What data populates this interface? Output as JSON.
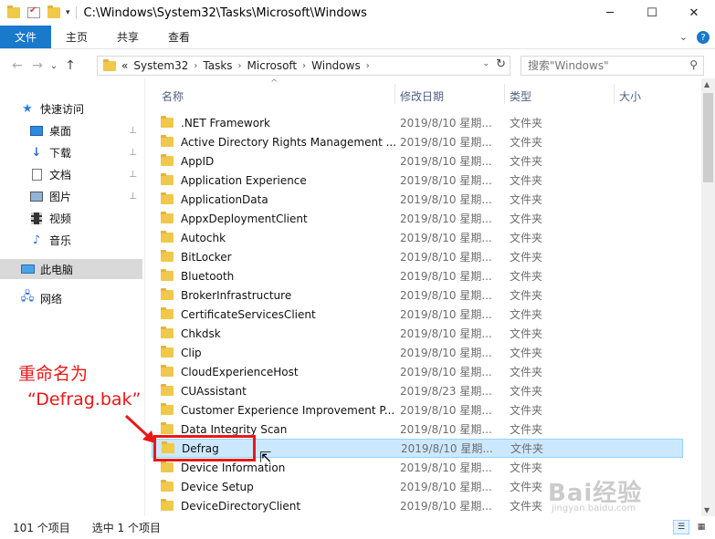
{
  "window": {
    "path_title": "C:\\Windows\\System32\\Tasks\\Microsoft\\Windows",
    "min_glyph": "─",
    "max_glyph": "☐",
    "close_glyph": "✕"
  },
  "ribbon": {
    "tabs": [
      "文件",
      "主页",
      "共享",
      "查看"
    ],
    "collapse_glyph": "⌄",
    "help_glyph": "?"
  },
  "nav": {
    "back_glyph": "←",
    "forward_glyph": "→",
    "recent_glyph": "⌄",
    "up_glyph": "↑",
    "breadcrumb_prefix": "«",
    "breadcrumbs": [
      "System32",
      "Tasks",
      "Microsoft",
      "Windows"
    ],
    "crumb_sep": "›",
    "refresh_glyph": "↻",
    "dropdown_glyph": "⌄"
  },
  "search": {
    "placeholder": "搜索\"Windows\"",
    "icon_glyph": "⚲"
  },
  "sidebar": {
    "quick_access": "快速访问",
    "items": [
      {
        "label": "桌面",
        "icon": "desktop-icon",
        "pinned": true
      },
      {
        "label": "下载",
        "icon": "download-icon",
        "pinned": true
      },
      {
        "label": "文档",
        "icon": "document-icon",
        "pinned": true
      },
      {
        "label": "图片",
        "icon": "picture-icon",
        "pinned": true
      },
      {
        "label": "视频",
        "icon": "video-icon",
        "pinned": false
      },
      {
        "label": "音乐",
        "icon": "music-icon",
        "pinned": false
      }
    ],
    "this_pc": "此电脑",
    "network": "网络",
    "pin_glyph": "📌"
  },
  "columns": {
    "name": "名称",
    "date": "修改日期",
    "type": "类型",
    "size": "大小",
    "sort_glyph": "^"
  },
  "files": [
    {
      "name": ".NET Framework",
      "date": "2019/8/10 星期...",
      "type": "文件夹"
    },
    {
      "name": "Active Directory Rights Management ...",
      "date": "2019/8/10 星期...",
      "type": "文件夹"
    },
    {
      "name": "AppID",
      "date": "2019/8/10 星期...",
      "type": "文件夹"
    },
    {
      "name": "Application Experience",
      "date": "2019/8/10 星期...",
      "type": "文件夹"
    },
    {
      "name": "ApplicationData",
      "date": "2019/8/10 星期...",
      "type": "文件夹"
    },
    {
      "name": "AppxDeploymentClient",
      "date": "2019/8/10 星期...",
      "type": "文件夹"
    },
    {
      "name": "Autochk",
      "date": "2019/8/10 星期...",
      "type": "文件夹"
    },
    {
      "name": "BitLocker",
      "date": "2019/8/10 星期...",
      "type": "文件夹"
    },
    {
      "name": "Bluetooth",
      "date": "2019/8/10 星期...",
      "type": "文件夹"
    },
    {
      "name": "BrokerInfrastructure",
      "date": "2019/8/10 星期...",
      "type": "文件夹"
    },
    {
      "name": "CertificateServicesClient",
      "date": "2019/8/10 星期...",
      "type": "文件夹"
    },
    {
      "name": "Chkdsk",
      "date": "2019/8/10 星期...",
      "type": "文件夹"
    },
    {
      "name": "Clip",
      "date": "2019/8/10 星期...",
      "type": "文件夹"
    },
    {
      "name": "CloudExperienceHost",
      "date": "2019/8/10 星期...",
      "type": "文件夹"
    },
    {
      "name": "CUAssistant",
      "date": "2019/8/23 星期...",
      "type": "文件夹"
    },
    {
      "name": "Customer Experience Improvement P...",
      "date": "2019/8/10 星期...",
      "type": "文件夹"
    },
    {
      "name": "Data Integrity Scan",
      "date": "2019/8/10 星期...",
      "type": "文件夹"
    },
    {
      "name": "Defrag",
      "date": "2019/8/10 星期...",
      "type": "文件夹",
      "selected": true
    },
    {
      "name": "Device Information",
      "date": "2019/8/10 星期...",
      "type": "文件夹"
    },
    {
      "name": "Device Setup",
      "date": "2019/8/10 星期...",
      "type": "文件夹"
    },
    {
      "name": "DeviceDirectoryClient",
      "date": "2019/8/10 星期...",
      "type": "文件夹"
    }
  ],
  "status": {
    "item_count": "101 个项目",
    "selected": "选中 1 个项目"
  },
  "annotation": {
    "line1": "重命名为",
    "line2": "“Defrag.bak”",
    "color": "#e81818"
  },
  "watermark": {
    "brand": "Bai经验",
    "url": "jingyan.baidu.com"
  },
  "colors": {
    "accent": "#1979ca",
    "selection_bg": "#cce8ff",
    "selection_border": "#99d1ff",
    "folder": "#f0c84a"
  }
}
